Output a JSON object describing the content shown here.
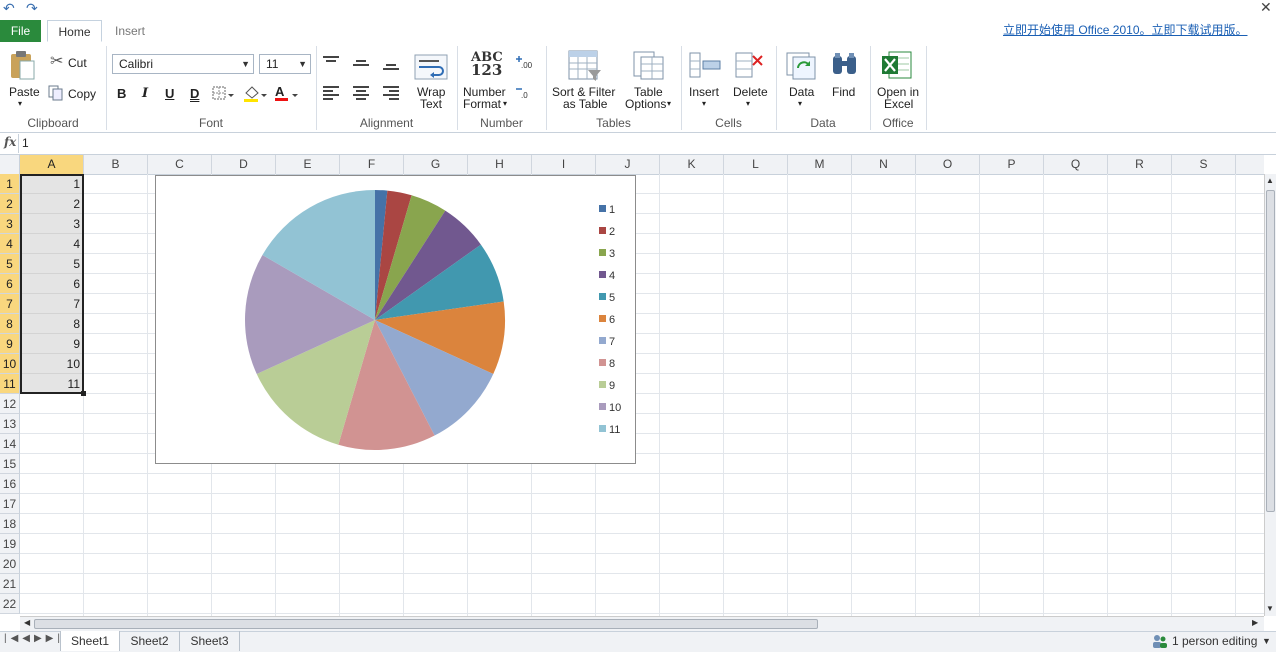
{
  "tabs": {
    "file": "File",
    "home": "Home",
    "insert": "Insert"
  },
  "promo": "立即开始使用 Office 2010。立即下载试用版。",
  "ribbon": {
    "clipboard": {
      "paste": "Paste",
      "cut": "Cut",
      "copy": "Copy",
      "label": "Clipboard"
    },
    "font": {
      "name": "Calibri",
      "size": "11",
      "bold": "B",
      "italic": "I",
      "underline": "U",
      "double_underline": "D",
      "label": "Font"
    },
    "alignment": {
      "wrap_line1": "Wrap",
      "wrap_line2": "Text",
      "label": "Alignment"
    },
    "number": {
      "icon_line1": "ABC",
      "icon_line2": "123",
      "format_line1": "Number",
      "format_line2": "Format",
      "label": "Number"
    },
    "tables": {
      "sort_line1": "Sort & Filter",
      "sort_line2": "as Table",
      "options_line1": "Table",
      "options_line2": "Options",
      "label": "Tables"
    },
    "cells": {
      "insert": "Insert",
      "delete": "Delete",
      "label": "Cells"
    },
    "data": {
      "data": "Data",
      "find": "Find",
      "label": "Data"
    },
    "office": {
      "open_line1": "Open in",
      "open_line2": "Excel",
      "label": "Office"
    }
  },
  "formula": {
    "fx": "fx",
    "value": "1"
  },
  "columns": [
    "A",
    "B",
    "C",
    "D",
    "E",
    "F",
    "G",
    "H",
    "I",
    "J",
    "K",
    "L",
    "M",
    "N",
    "O",
    "P",
    "Q",
    "R",
    "S"
  ],
  "rows": [
    "1",
    "2",
    "3",
    "4",
    "5",
    "6",
    "7",
    "8",
    "9",
    "10",
    "11",
    "12",
    "13",
    "14",
    "15",
    "16",
    "17",
    "18",
    "19",
    "20",
    "21",
    "22"
  ],
  "cells_a": [
    "1",
    "2",
    "3",
    "4",
    "5",
    "6",
    "7",
    "8",
    "9",
    "10",
    "11"
  ],
  "chart_data": {
    "type": "pie",
    "categories": [
      "1",
      "2",
      "3",
      "4",
      "5",
      "6",
      "7",
      "8",
      "9",
      "10",
      "11"
    ],
    "values": [
      1,
      2,
      3,
      4,
      5,
      6,
      7,
      8,
      9,
      10,
      11
    ],
    "colors": [
      "#4572a7",
      "#aa4643",
      "#89a54e",
      "#71588f",
      "#4198af",
      "#db843d",
      "#93a9cf",
      "#d19392",
      "#b9cd96",
      "#a99bbd",
      "#92c3d4"
    ],
    "legend_position": "right"
  },
  "sheets": [
    "Sheet1",
    "Sheet2",
    "Sheet3"
  ],
  "status": {
    "editing": "1 person editing"
  }
}
